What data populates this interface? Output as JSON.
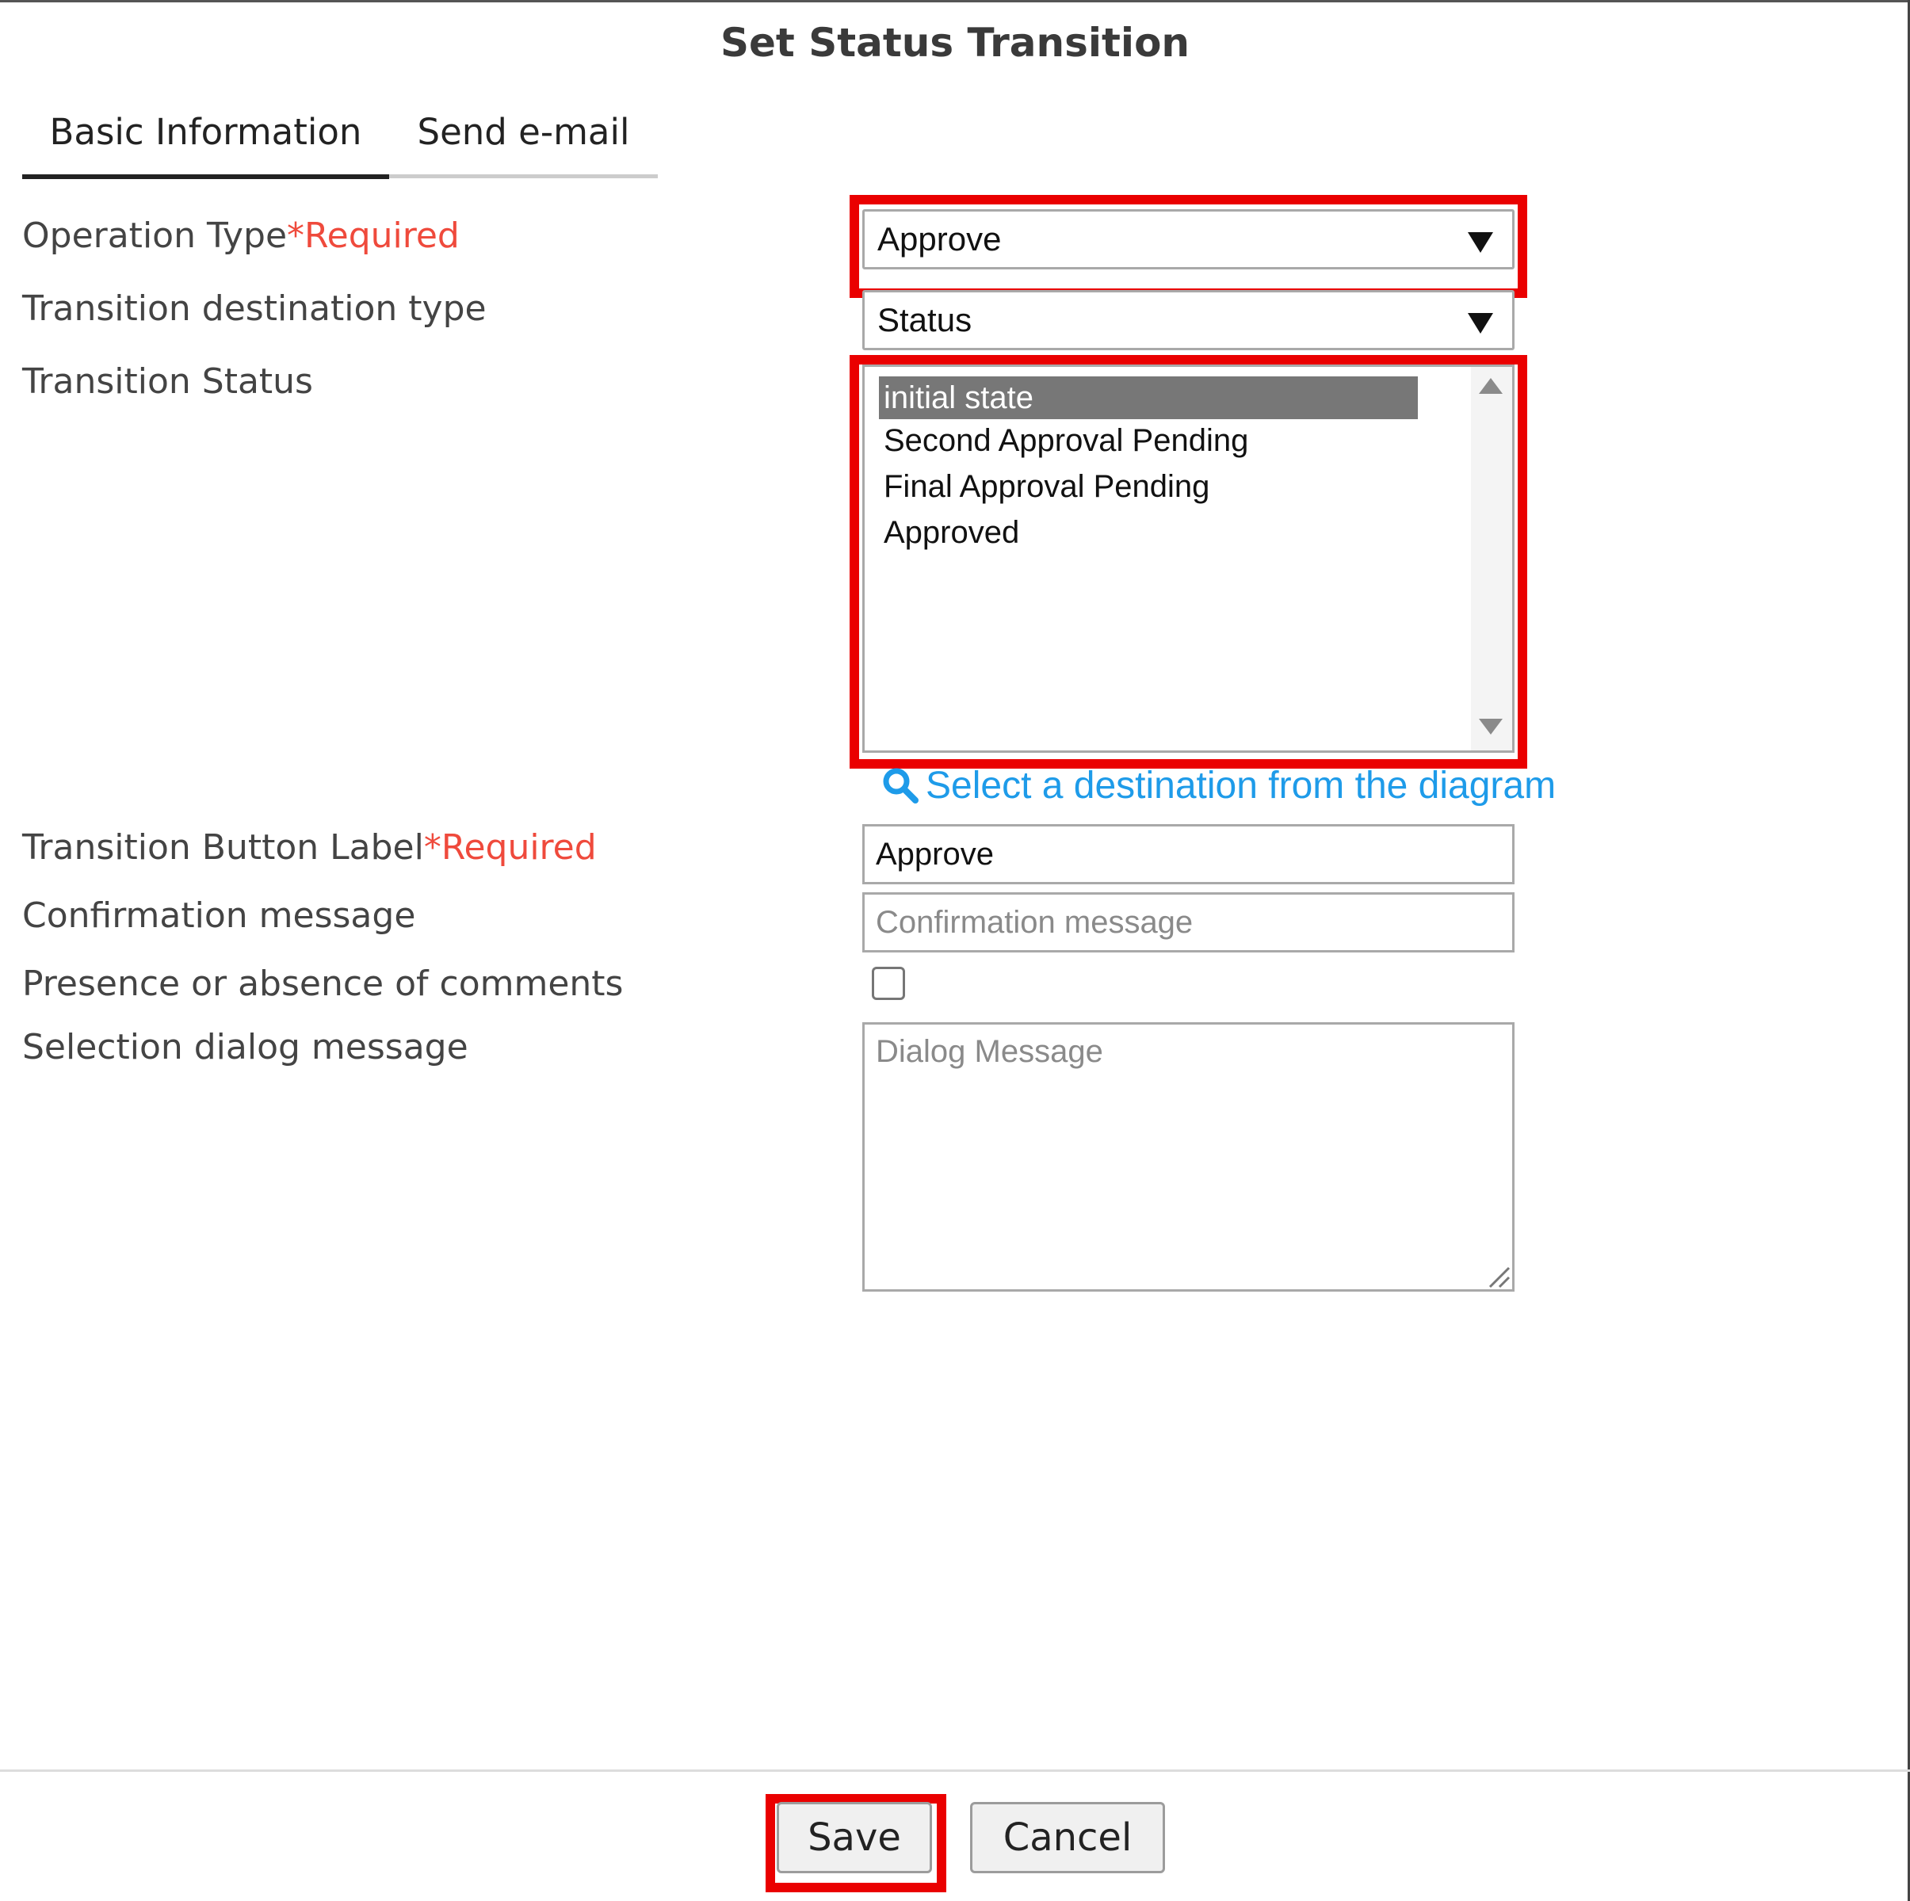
{
  "dialog": {
    "title": "Set Status Transition"
  },
  "tabs": [
    {
      "label": "Basic Information",
      "active": true
    },
    {
      "label": "Send e-mail",
      "active": false
    }
  ],
  "fields": {
    "operation_type": {
      "label": "Operation Type",
      "required": "*Required",
      "value": "Approve"
    },
    "destination_type": {
      "label": "Transition destination type",
      "value": "Status"
    },
    "transition_status": {
      "label": "Transition Status",
      "options": [
        "initial state",
        "Second Approval Pending",
        "Final Approval Pending",
        "Approved"
      ],
      "selected": "initial state"
    },
    "diagram_link": {
      "label": "Select a destination from the diagram",
      "icon": "search-icon"
    },
    "button_label": {
      "label": "Transition Button Label",
      "required": "*Required",
      "value": "Approve"
    },
    "confirmation_message": {
      "label": "Confirmation message",
      "value": "",
      "placeholder": "Confirmation message"
    },
    "comments": {
      "label": "Presence or absence of comments",
      "checked": false
    },
    "dialog_message": {
      "label": "Selection dialog message",
      "value": "",
      "placeholder": "Dialog Message"
    }
  },
  "footer": {
    "save_label": "Save",
    "cancel_label": "Cancel"
  },
  "colors": {
    "highlight": "#ea0000",
    "required": "#ef4a3c",
    "link": "#1e9be9",
    "selected_option_bg": "#777777"
  }
}
